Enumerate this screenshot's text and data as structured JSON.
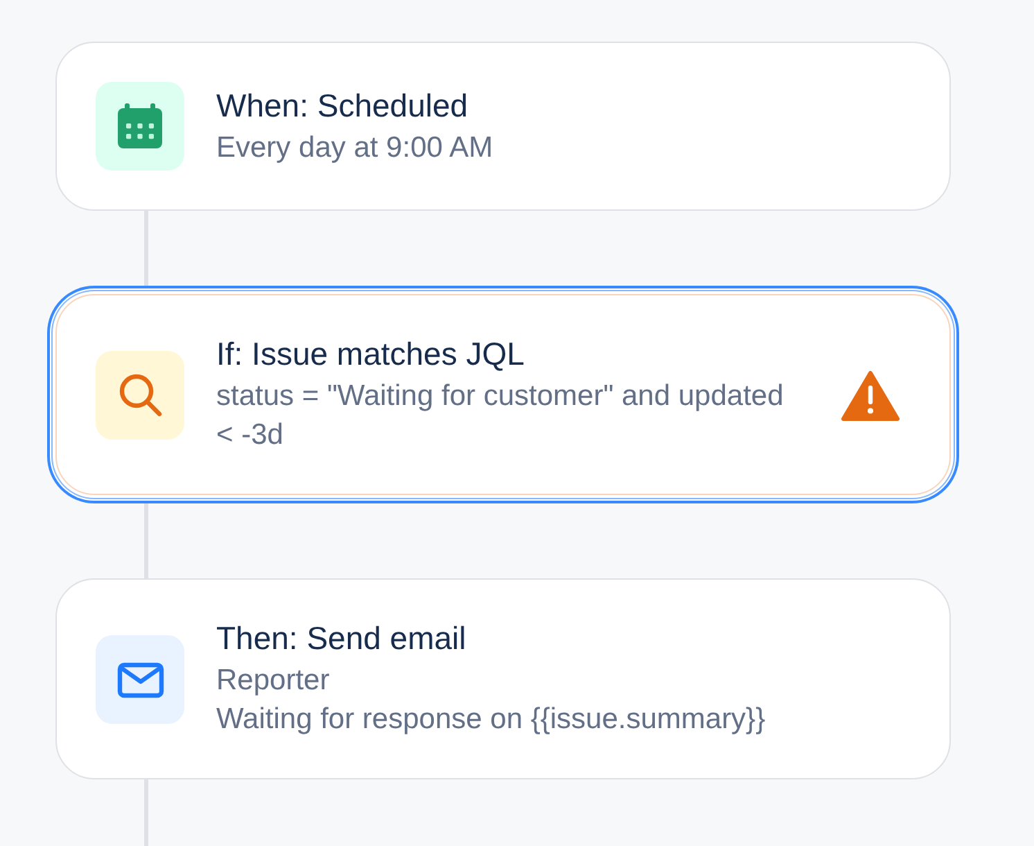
{
  "steps": [
    {
      "kind": "trigger",
      "title": "When: Scheduled",
      "details": [
        "Every day at 9:00 AM"
      ],
      "selected": false,
      "warning": false
    },
    {
      "kind": "condition",
      "title": "If: Issue matches JQL",
      "details": [
        "status = \"Waiting for customer\" and updated < -3d"
      ],
      "selected": true,
      "warning": true
    },
    {
      "kind": "action",
      "title": "Then: Send email",
      "details": [
        "Reporter",
        "Waiting for response on {{issue.summary}}"
      ],
      "selected": false,
      "warning": false
    }
  ]
}
